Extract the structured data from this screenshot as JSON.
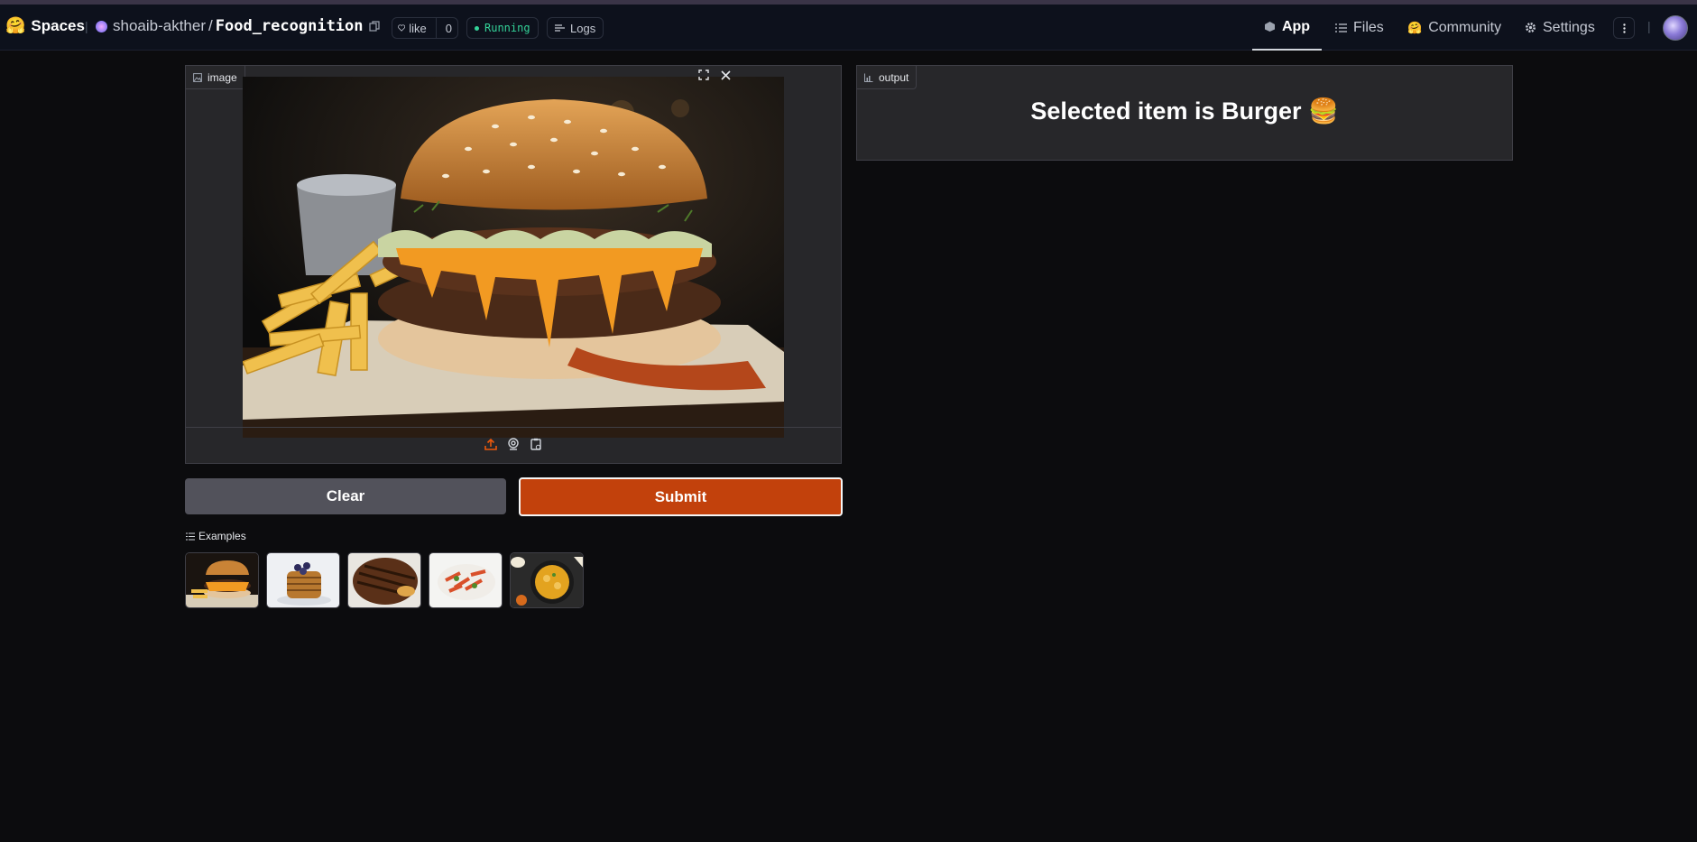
{
  "header": {
    "spaces_label": "Spaces",
    "repo_owner": "shoaib-akther",
    "repo_slash": "/",
    "repo_name": "Food_recognition",
    "like_label": "like",
    "like_count": "0",
    "status": "Running",
    "logs_label": "Logs",
    "tabs": [
      {
        "label": "App",
        "icon": "app-cube-icon",
        "active": true
      },
      {
        "label": "Files",
        "icon": "files-icon",
        "active": false
      },
      {
        "label": "Community",
        "icon": "community-icon",
        "active": false
      },
      {
        "label": "Settings",
        "icon": "gear-icon",
        "active": false
      }
    ]
  },
  "input_panel": {
    "label": "image"
  },
  "output_panel": {
    "label": "output",
    "result": "Selected item is Burger 🍔"
  },
  "buttons": {
    "clear": "Clear",
    "submit": "Submit"
  },
  "examples": {
    "label": "Examples",
    "items": [
      "burger",
      "pancakes",
      "steak",
      "pasta",
      "curry"
    ]
  },
  "colors": {
    "submit": "#c2410c",
    "clear": "#52525b",
    "panel": "#27272a",
    "background": "#0c0c0e",
    "running": "#34d399"
  }
}
